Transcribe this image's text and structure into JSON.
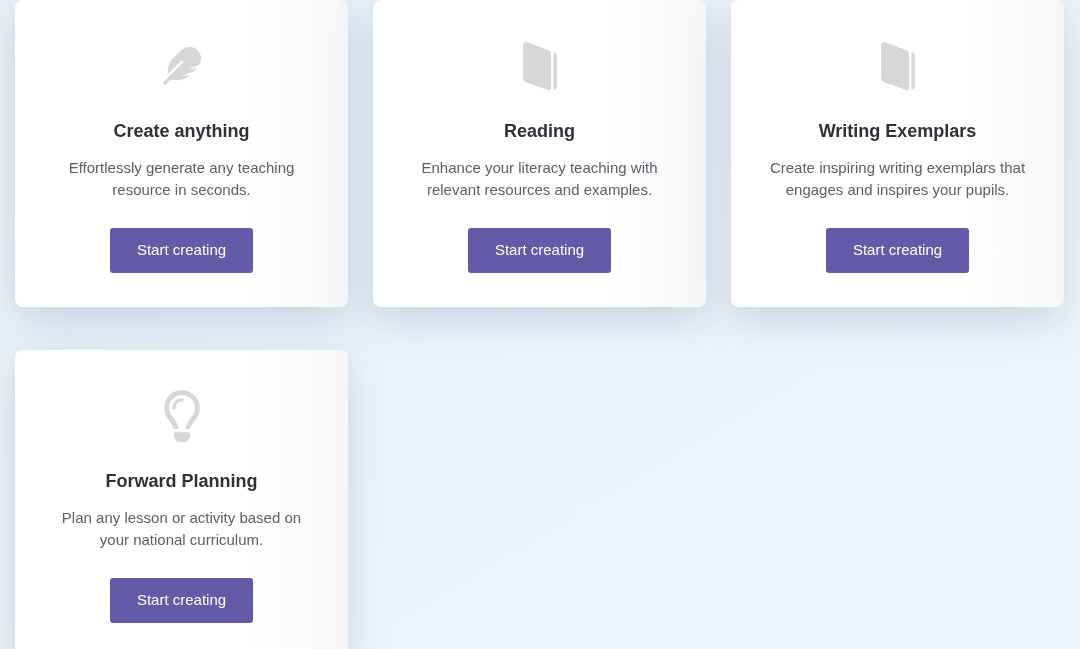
{
  "cards": [
    {
      "title": "Create anything",
      "description": "Effortlessly generate any teaching resource in seconds.",
      "button": "Start creating"
    },
    {
      "title": "Reading",
      "description": "Enhance your literacy teaching with relevant resources and examples.",
      "button": "Start creating"
    },
    {
      "title": "Writing Exemplars",
      "description": "Create inspiring writing exemplars that engages and inspires your pupils.",
      "button": "Start creating"
    },
    {
      "title": "Forward Planning",
      "description": "Plan any lesson or activity based on your national curriculum.",
      "button": "Start creating"
    }
  ]
}
